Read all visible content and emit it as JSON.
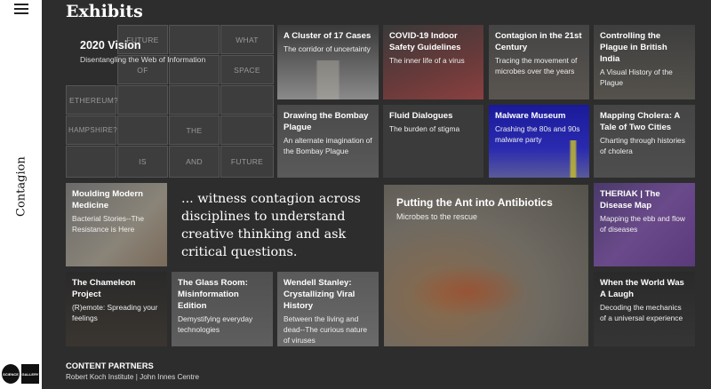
{
  "sidebar": {
    "section_label": "Contagion",
    "logo_left": "SCIENCE",
    "logo_right": "GALLERY"
  },
  "page_title": "Exhibits",
  "vision": {
    "title": "2020 Vision",
    "subtitle": "Disentangling the Web of Information",
    "words": [
      "FUTURE",
      "WHAT",
      "OF",
      "SPACE",
      "ETHEREUM?",
      "HAMPSHIRE?",
      "THE",
      "IS",
      "AND",
      "FUTURE"
    ]
  },
  "cards": [
    {
      "title": "A Cluster of 17 Cases",
      "subtitle": "The corridor of uncertainty"
    },
    {
      "title": "COVID-19 Indoor Safety Guidelines",
      "subtitle": "The inner life of a virus"
    },
    {
      "title": "Contagion in the 21st Century",
      "subtitle": "Tracing the movement of microbes over the years"
    },
    {
      "title": "Controlling the Plague in British India",
      "subtitle": "A Visual History of the Plague"
    },
    {
      "title": "Drawing the Bombay Plague",
      "subtitle": "An alternate imagination of the Bombay Plague"
    },
    {
      "title": "Fluid Dialogues",
      "subtitle": "The burden of stigma"
    },
    {
      "title": "Malware Museum",
      "subtitle": "Crashing the 80s and 90s malware party"
    },
    {
      "title": "Mapping Cholera: A Tale of Two Cities",
      "subtitle": "Charting through histories of cholera"
    },
    {
      "title": "Moulding Modern Medicine",
      "subtitle": "Bacterial Stories--The Resistance is Here"
    },
    {
      "title": "THERIAK | The Disease Map",
      "subtitle": "Mapping the ebb and flow of diseases"
    },
    {
      "title": "The Chameleon Project",
      "subtitle": "(R)emote: Spreading your feelings"
    },
    {
      "title": "The Glass Room: Misinformation Edition",
      "subtitle": "Demystifying everyday technologies"
    },
    {
      "title": "Wendell Stanley: Crystallizing Viral History",
      "subtitle": "Between the living and dead--The curious nature of viruses"
    },
    {
      "title": "When the World Was A Laugh",
      "subtitle": "Decoding the mechanics of a universal experience"
    }
  ],
  "quote": "... witness contagion across disciplines to understand creative thinking and ask critical questions.",
  "feature": {
    "title": "Putting the Ant into Antibiotics",
    "subtitle": "Microbes to the rescue"
  },
  "partners": {
    "heading": "CONTENT PARTNERS",
    "names": "Robert Koch Institute | John Innes Centre"
  }
}
